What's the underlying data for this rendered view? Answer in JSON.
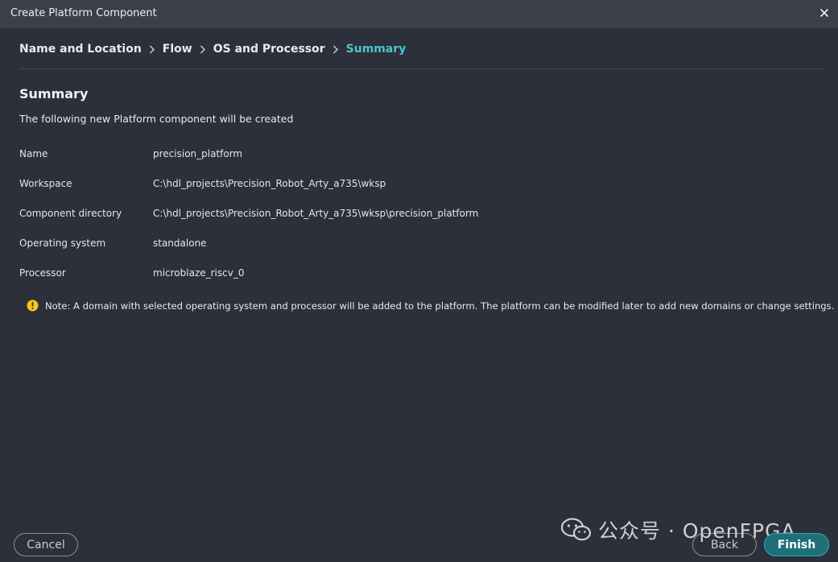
{
  "window": {
    "title": "Create Platform Component"
  },
  "breadcrumb": {
    "steps": [
      {
        "label": "Name and Location"
      },
      {
        "label": "Flow"
      },
      {
        "label": "OS and Processor"
      },
      {
        "label": "Summary"
      }
    ]
  },
  "summary": {
    "heading": "Summary",
    "description": "The following new Platform component will be created",
    "rows": [
      {
        "label": "Name",
        "value": "precision_platform"
      },
      {
        "label": "Workspace",
        "value": "C:\\hdl_projects\\Precision_Robot_Arty_a735\\wksp"
      },
      {
        "label": "Component directory",
        "value": "C:\\hdl_projects\\Precision_Robot_Arty_a735\\wksp\\precision_platform"
      },
      {
        "label": "Operating system",
        "value": "standalone"
      },
      {
        "label": "Processor",
        "value": "microblaze_riscv_0"
      }
    ],
    "note": "Note: A domain with selected operating system and processor will be added to the platform. The platform can be modified later to add new domains or change settings."
  },
  "buttons": {
    "cancel": "Cancel",
    "back": "Back",
    "finish": "Finish"
  },
  "watermark": {
    "text": "公众号 · OpenFPGA"
  },
  "colors": {
    "background": "#2b303b",
    "titlebar": "#3a3f4a",
    "accent": "#4fc3c9",
    "finish_bg": "#1f6f79",
    "warning": "#f5c518"
  },
  "icons": {
    "close": "close-icon",
    "separator": "chevron-right-icon",
    "note": "warning-icon",
    "watermark": "wechat-icon"
  }
}
